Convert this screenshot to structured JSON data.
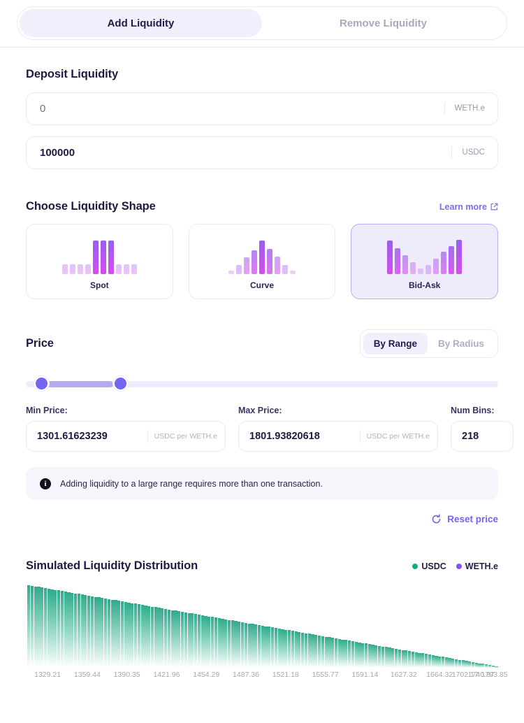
{
  "tabs": [
    {
      "label": "Add Liquidity",
      "active": true
    },
    {
      "label": "Remove Liquidity",
      "active": false
    }
  ],
  "deposit": {
    "title": "Deposit Liquidity",
    "fields": [
      {
        "value": "",
        "placeholder": "0",
        "token": "WETH.e"
      },
      {
        "value": "100000",
        "placeholder": "0",
        "token": "USDC"
      }
    ]
  },
  "shape": {
    "title": "Choose Liquidity Shape",
    "learn_more": "Learn more",
    "learn_more_icon": "external-link-icon",
    "options": [
      {
        "label": "Spot",
        "selected": false,
        "bars": [
          14,
          14,
          14,
          14,
          48,
          48,
          48,
          14,
          14,
          14
        ]
      },
      {
        "label": "Curve",
        "selected": false,
        "bars": [
          5,
          13,
          24,
          34,
          48,
          36,
          25,
          13,
          5
        ]
      },
      {
        "label": "Bid-Ask",
        "selected": true,
        "bars": [
          48,
          37,
          27,
          17,
          8,
          13,
          22,
          32,
          40,
          49
        ]
      }
    ]
  },
  "price": {
    "title": "Price",
    "modes": [
      {
        "label": "By Range",
        "active": true
      },
      {
        "label": "By Radius",
        "active": false
      }
    ],
    "slider": {
      "min_pct": 1.8,
      "max_pct": 18.5
    },
    "min_price": {
      "label": "Min Price:",
      "value": "1301.61623239",
      "unit": "USDC per WETH.e"
    },
    "max_price": {
      "label": "Max Price:",
      "value": "1801.93820618",
      "unit": "USDC per WETH.e"
    },
    "num_bins": {
      "label": "Num Bins:",
      "value": "218"
    },
    "notice": {
      "icon": "info-icon",
      "text": "Adding liquidity to a large range requires more than one transaction."
    },
    "reset": {
      "label": "Reset price",
      "icon": "refresh-icon"
    }
  },
  "simulation": {
    "title": "Simulated Liquidity Distribution",
    "legend": [
      {
        "label": "USDC",
        "color": "#16a97e"
      },
      {
        "label": "WETH.e",
        "color": "#8a4ff2"
      }
    ]
  },
  "chart_data": {
    "type": "bar",
    "title": "Simulated Liquidity Distribution",
    "xlabel": "",
    "ylabel": "",
    "grid": false,
    "legend_position": "top-right",
    "bar_color": "#2fab8b",
    "series": [
      {
        "name": "USDC",
        "color": "#16a97e",
        "values": [
          100,
          99.3,
          98.6,
          97.9,
          97.2,
          96.5,
          95.8,
          95.1,
          94.4,
          93.7,
          93.0,
          92.3,
          91.6,
          90.9,
          90.2,
          89.5,
          88.8,
          88.1,
          87.4,
          86.7,
          86.0,
          85.3,
          84.6,
          83.9,
          83.2,
          82.5,
          81.8,
          81.1,
          80.4,
          79.7,
          79.0,
          78.3,
          77.6,
          76.9,
          76.2,
          75.5,
          74.8,
          74.1,
          73.4,
          72.7,
          72.0,
          71.3,
          70.6,
          69.9,
          69.2,
          68.5,
          67.8,
          67.1,
          66.4,
          65.7,
          65.0,
          64.3,
          63.6,
          62.9,
          62.2,
          61.5,
          60.8,
          60.1,
          59.4,
          58.7,
          58.0,
          57.3,
          56.6,
          55.9,
          55.2,
          54.5,
          53.8,
          53.1,
          52.4,
          51.7,
          51.0,
          50.3,
          49.6,
          48.9,
          48.2,
          47.5,
          46.8,
          46.1,
          45.4,
          44.7,
          44.0,
          43.3,
          42.6,
          41.9,
          41.2,
          40.5,
          39.8,
          39.1,
          38.4,
          37.7,
          37.0,
          36.3,
          35.6,
          34.9,
          34.2,
          33.5,
          32.8,
          32.1,
          31.4,
          30.7,
          30.0,
          29.3,
          28.6,
          27.9,
          27.2,
          26.5,
          25.8,
          25.1,
          24.4,
          23.7,
          23.0,
          22.3,
          21.6,
          20.9,
          20.2,
          19.5,
          18.8,
          18.1,
          17.4,
          16.7,
          16.0,
          15.3,
          14.6,
          13.9,
          13.2,
          12.5,
          11.8,
          11.1,
          10.4,
          9.7,
          9.0,
          8.3,
          7.6,
          6.9,
          6.2,
          5.5,
          4.8,
          4.1,
          3.4,
          2.7,
          2.0
        ]
      }
    ],
    "tick_labels": [
      "1329.21",
      "1359.44",
      "1390.35",
      "1421.96",
      "1454.29",
      "1487.36",
      "1521.18",
      "1555.77",
      "1591.14",
      "1627.32",
      "1664.32",
      "1702.17",
      "1740.87",
      "1793.85"
    ],
    "tick_positions_pct": [
      4.6,
      13.0,
      21.4,
      29.8,
      38.2,
      46.6,
      55.0,
      63.4,
      71.8,
      80.0,
      87.6,
      93.0,
      96.4,
      99.2
    ]
  }
}
